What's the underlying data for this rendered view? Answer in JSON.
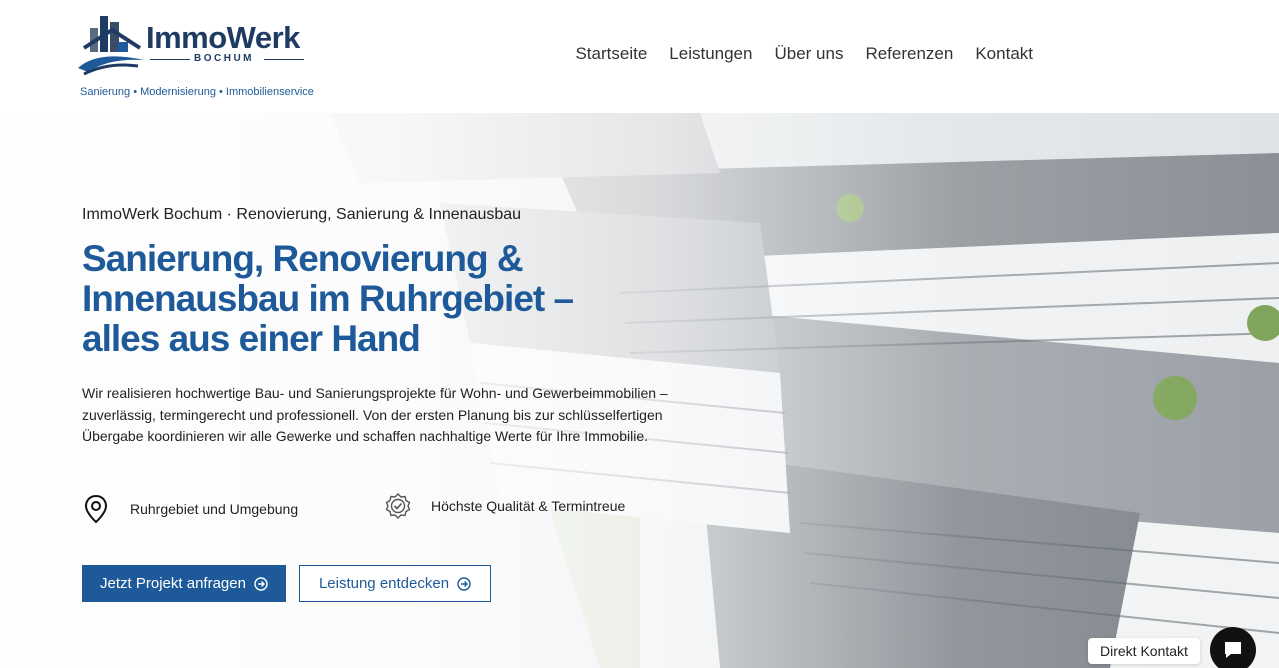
{
  "brand": {
    "name": "ImmoWerk",
    "city": "BOCHUM",
    "tagline": "Sanierung • Modernisierung • Immobilienservice"
  },
  "nav": {
    "items": [
      {
        "label": "Startseite"
      },
      {
        "label": "Leistungen"
      },
      {
        "label": "Über uns"
      },
      {
        "label": "Referenzen"
      },
      {
        "label": "Kontakt"
      }
    ]
  },
  "hero": {
    "kicker": "ImmoWerk Bochum · Renovierung, Sanierung & Innenausbau",
    "headline": "Sanierung, Renovierung & Innenausbau im Ruhrgebiet – alles aus einer Hand",
    "intro": "Wir realisieren hochwertige Bau- und Sanierungsprojekte für Wohn- und Gewerbeimmobilien – zuverlässig, termingerecht und professionell. Von der ersten Planung bis zur schlüsselfertigen Übergabe koordinieren wir alle Gewerke und schaffen nachhaltige Werte für Ihre Immobilie.",
    "features": [
      {
        "icon": "map-pin-icon",
        "label": "Ruhrgebiet und Umgebung"
      },
      {
        "icon": "quality-badge-icon",
        "label": "Höchste Qualität & Termintreue"
      }
    ],
    "cta_primary": "Jetzt Projekt anfragen",
    "cta_secondary": "Leistung entdecken"
  },
  "contact_widget": {
    "label": "Direkt Kontakt",
    "icon": "chat-icon"
  },
  "colors": {
    "brand_dark": "#1e3b63",
    "brand_blue": "#1e5a9a",
    "chat_bg": "#111111"
  }
}
